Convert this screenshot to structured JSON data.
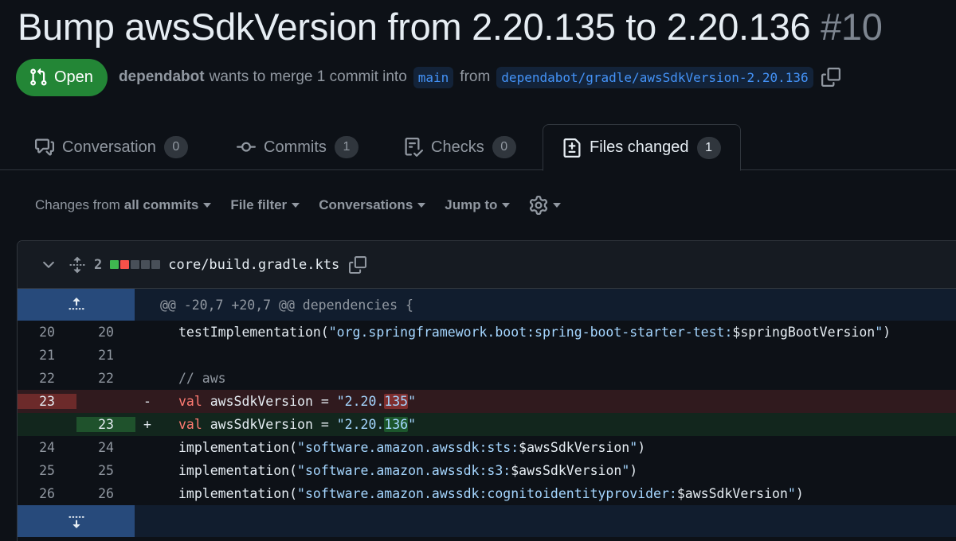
{
  "pr": {
    "title": "Bump awsSdkVersion from 2.20.135 to 2.20.136",
    "number": "#10",
    "state": "Open",
    "author": "dependabot",
    "merge_text": "wants to merge 1 commit into",
    "base_branch": "main",
    "from_text": "from",
    "head_branch": "dependabot/gradle/awsSdkVersion-2.20.136"
  },
  "tabs": [
    {
      "label": "Conversation",
      "count": "0",
      "icon": "comment-discussion-icon"
    },
    {
      "label": "Commits",
      "count": "1",
      "icon": "git-commit-icon"
    },
    {
      "label": "Checks",
      "count": "0",
      "icon": "checklist-icon"
    },
    {
      "label": "Files changed",
      "count": "1",
      "icon": "file-diff-icon",
      "active": true
    }
  ],
  "toolbar": {
    "changes_prefix": "Changes from",
    "changes_value": "all commits",
    "file_filter": "File filter",
    "conversations": "Conversations",
    "jump_to": "Jump to"
  },
  "file": {
    "diff_count": "2",
    "name": "core/build.gradle.kts",
    "hunk_header": "@@ -20,7 +20,7 @@ dependencies {",
    "lines": [
      {
        "old": "20",
        "new": "20",
        "marker": "",
        "text": "testImplementation(\"org.springframework.boot:spring-boot-starter-test:$springBootVersion\")"
      },
      {
        "old": "21",
        "new": "21",
        "marker": "",
        "text": ""
      },
      {
        "old": "22",
        "new": "22",
        "marker": "",
        "text": "// aws"
      },
      {
        "old": "23",
        "new": "",
        "marker": "-",
        "text": "val awsSdkVersion = \"2.20.135\""
      },
      {
        "old": "",
        "new": "23",
        "marker": "+",
        "text": "val awsSdkVersion = \"2.20.136\""
      },
      {
        "old": "24",
        "new": "24",
        "marker": "",
        "text": "implementation(\"software.amazon.awssdk:sts:$awsSdkVersion\")"
      },
      {
        "old": "25",
        "new": "25",
        "marker": "",
        "text": "implementation(\"software.amazon.awssdk:s3:$awsSdkVersion\")"
      },
      {
        "old": "26",
        "new": "26",
        "marker": "",
        "text": "implementation(\"software.amazon.awssdk:cognitoidentityprovider:$awsSdkVersion\")"
      }
    ]
  },
  "colors": {
    "open_green": "#238636",
    "link_blue": "#4493f8",
    "added_green": "#3fb950",
    "deleted_red": "#f85149"
  }
}
